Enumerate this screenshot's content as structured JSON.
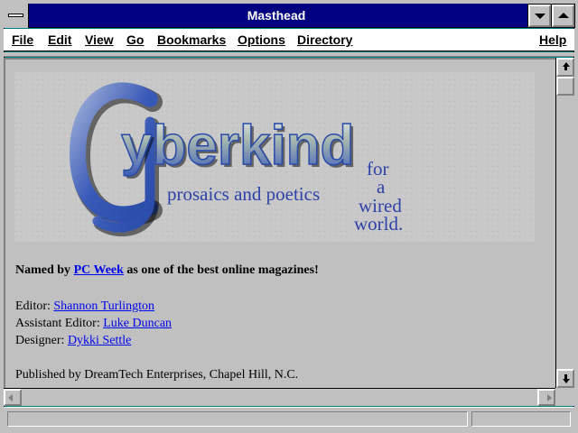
{
  "window": {
    "title": "Masthead"
  },
  "menu": [
    "File",
    "Edit",
    "View",
    "Go",
    "Bookmarks",
    "Options",
    "Directory",
    "Help"
  ],
  "banner": {
    "logo": "Cyberkind",
    "tagline": "prosaics and poetics",
    "tagline2": [
      "for",
      "a",
      "wired",
      "world."
    ]
  },
  "content": {
    "award_prefix": "Named by",
    "award_link": "PC Week",
    "award_suffix": "as one of the best online magazines!",
    "credits": [
      {
        "role": "Editor:",
        "name": "Shannon Turlington"
      },
      {
        "role": "Assistant Editor:",
        "name": "Luke Duncan"
      },
      {
        "role": "Designer:",
        "name": "Dykki Settle"
      }
    ],
    "publisher": "Published by DreamTech Enterprises, Chapel Hill, N.C."
  },
  "status": {
    "text": ""
  },
  "colors": {
    "titlebar": "#000080",
    "link": "#0000ee",
    "logo_blue": "#3a5ab8"
  }
}
